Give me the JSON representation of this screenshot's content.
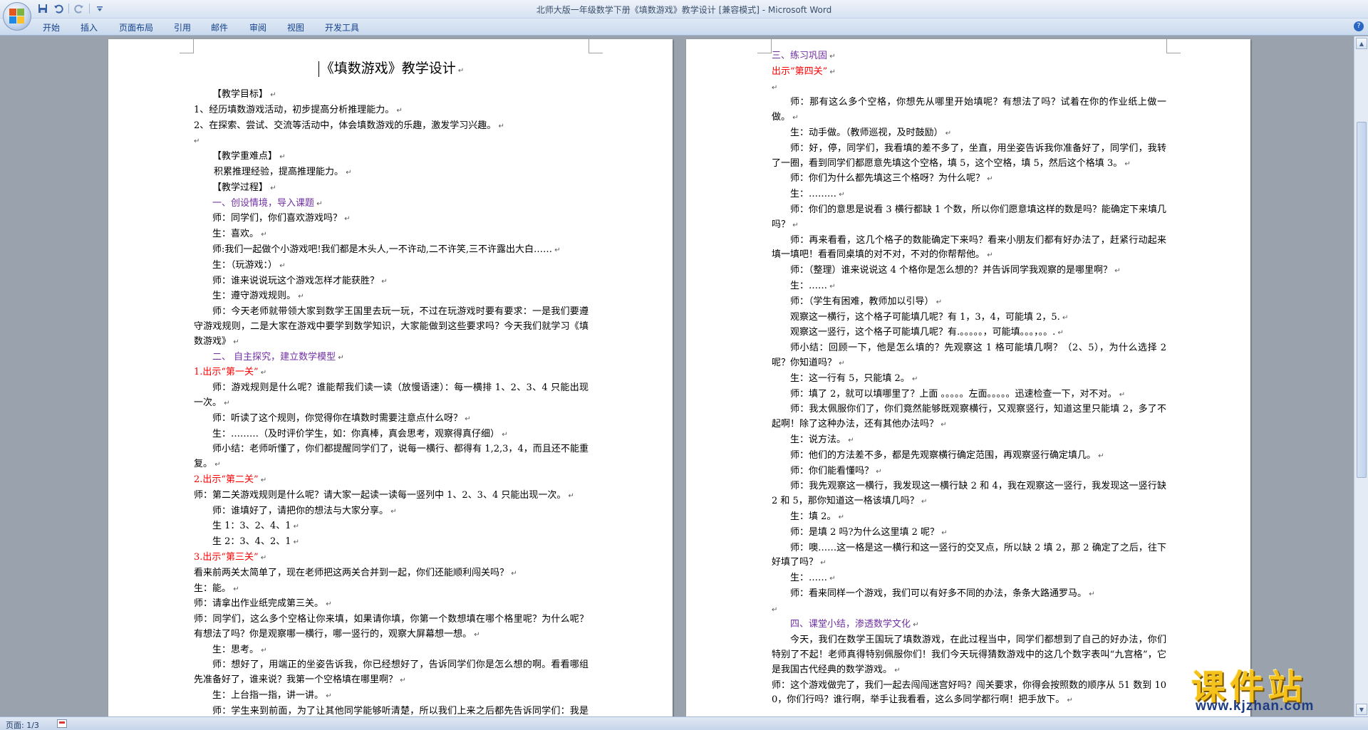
{
  "window": {
    "title": "北师大版一年级数学下册《填数游戏》教学设计 [兼容模式] - Microsoft Word"
  },
  "quick_access": {
    "icons": [
      "save-icon",
      "undo-icon",
      "redo-icon",
      "customize-icon"
    ]
  },
  "ribbon": {
    "tabs": [
      "开始",
      "插入",
      "页面布局",
      "引用",
      "邮件",
      "审阅",
      "视图",
      "开发工具"
    ],
    "help_label": "?"
  },
  "page_left": {
    "title": "《填数游戏》教学设计",
    "paragraphs": [
      {
        "text": "【教学目标】",
        "style": "ind"
      },
      {
        "text": "1、经历填数游戏活动，初步提高分析推理能力。",
        "style": ""
      },
      {
        "text": "2、在探索、尝试、交流等活动中，体会填数游戏的乐趣，激发学习兴趣。",
        "style": ""
      },
      {
        "text": "",
        "style": ""
      },
      {
        "text": "【教学重难点】",
        "style": "ind"
      },
      {
        "text": "积累推理经验，提高推理能力。",
        "style": "ind1"
      },
      {
        "text": "【教学过程】",
        "style": "ind"
      },
      {
        "text": "一、创设情境，导入课题",
        "style": "ind purple"
      },
      {
        "text": "师：同学们，你们喜欢游戏吗？",
        "style": "ind"
      },
      {
        "text": "生：喜欢。",
        "style": "ind"
      },
      {
        "text": "师:我们一起做个小游戏吧!我们都是木头人,一不许动,二不许笑,三不许露出大白……",
        "style": "ind"
      },
      {
        "text": "生：（玩游戏：）",
        "style": "ind"
      },
      {
        "text": "师：谁来说说玩这个游戏怎样才能获胜？",
        "style": "ind"
      },
      {
        "text": "生：遵守游戏规则。",
        "style": "ind"
      },
      {
        "text": "师：今天老师就带领大家到数学王国里去玩一玩，不过在玩游戏时要有要求：一是我们要遵守游戏规则，二是大家在游戏中要学到数学知识，大家能做到这些要求吗？今天我们就学习《填数游戏》",
        "style": "ind"
      },
      {
        "text": "二、 自主探究，建立数学模型",
        "style": "ind purple"
      },
      {
        "text": "1.出示“第一关”",
        "style": "red"
      },
      {
        "text": "师：游戏规则是什么呢？谁能帮我们读一读（放慢语速）：每一横排 1、2、3、4 只能出现一次。",
        "style": "ind"
      },
      {
        "text": "师：听读了这个规则，你觉得你在填数时需要注意点什么呀？",
        "style": "ind"
      },
      {
        "text": "生：………（及时评价学生，如：你真棒，真会思考，观察得真仔细）",
        "style": "ind"
      },
      {
        "text": "师小结：老师听懂了，你们都提醒同学们了，说每一横行、都得有 1,2,3，4，而且还不能重复。",
        "style": "ind"
      },
      {
        "text": "2.出示“第二关”",
        "style": "red"
      },
      {
        "text": "师：第二关游戏规则是什么呢？请大家一起读一读每一竖列中 1、2、3、4 只能出现一次。",
        "style": ""
      },
      {
        "text": "师：谁填好了，请把你的想法与大家分享。",
        "style": "ind"
      },
      {
        "text": "生 1：3、2、4、1",
        "style": "ind"
      },
      {
        "text": "生 2：3、4、2、1",
        "style": "ind"
      },
      {
        "text": "3.出示“第三关”",
        "style": "red"
      },
      {
        "text": "看来前两关太简单了，现在老师把这两关合并到一起，你们还能顺利闯关吗？",
        "style": ""
      },
      {
        "text": "生：能。",
        "style": ""
      },
      {
        "text": "师：请拿出作业纸完成第三关。",
        "style": ""
      },
      {
        "text": "师：同学们，这么多个空格让你来填，如果请你填，你第一个数想填在哪个格里呢？为什么呢？有想法了吗？你是观察哪一横行，哪一竖行的，观察大屏幕想一想。",
        "style": ""
      },
      {
        "text": "生：思考。",
        "style": "ind"
      },
      {
        "text": "师：想好了，用端正的坐姿告诉我，你已经想好了，告诉同学们你是怎么想的啊。看看哪组先准备好了，谁来说？我第一个空格填在哪里啊？",
        "style": "ind"
      },
      {
        "text": "生：上台指一指，讲一讲。",
        "style": "ind"
      },
      {
        "text": "师：学生来到前面，为了让其他同学能够听清楚，所以我们上来之后都先告诉同学们：我是观察的这一横行，还是观察这一竖行，行吗？",
        "style": "ind"
      }
    ]
  },
  "page_right": {
    "paragraphs": [
      {
        "text": "三、练习巩固",
        "style": "purple"
      },
      {
        "text": "出示“第四关”",
        "style": "red"
      },
      {
        "text": "",
        "style": ""
      },
      {
        "text": "师：那有这么多个空格，你想先从哪里开始填呢？有想法了吗？试着在你的作业纸上做一做。",
        "style": "ind"
      },
      {
        "text": "生：动手做。（教师巡视，及时鼓励）",
        "style": "ind"
      },
      {
        "text": "师：好，停，同学们，我看填的差不多了，坐直，用坐姿告诉我你准备好了，同学们，我转了一圈，看到同学们都愿意先填这个空格，填 5，这个空格，填 5，然后这个格填 3。",
        "style": "ind"
      },
      {
        "text": "师：你们为什么都先填这三个格呀？为什么呢？",
        "style": "ind"
      },
      {
        "text": "生：………",
        "style": "ind"
      },
      {
        "text": "师：你们的意思是说看 3 横行都缺 1 个数，所以你们愿意填这样的数是吗？能确定下来填几吗？",
        "style": "ind"
      },
      {
        "text": "师：再来看看，这几个格子的数能确定下来吗？看来小朋友们都有好办法了，赶紧行动起来填一填吧！看看同桌填的对不对，不对的你帮帮他。",
        "style": "ind"
      },
      {
        "text": "师：（整理）谁来说说这 4 个格你是怎么想的？并告诉同学我观察的是哪里啊？",
        "style": "ind"
      },
      {
        "text": "生：……",
        "style": "ind"
      },
      {
        "text": "师：（学生有困难，教师加以引导）",
        "style": "ind"
      },
      {
        "text": "观察这一横行，这个格子可能填几呢？有 1，3，4，可能填 2，5.",
        "style": "ind"
      },
      {
        "text": "观察这一竖行，这个格子可能填几呢？有.。。。。。，可能填。。。，。。.",
        "style": "ind"
      },
      {
        "text": "师小结：回顾一下，他是怎么填的？先观察这 1 格可能填几啊？（2、5），为什么选择 2 呢？你知道吗？",
        "style": "ind"
      },
      {
        "text": "生：这一行有 5，只能填 2。",
        "style": "ind"
      },
      {
        "text": "师：填了 2，就可以填哪里了？上面 。。。。。左面。。。。。迅速检查一下，对不对。",
        "style": "ind"
      },
      {
        "text": "师：我太佩服你们了，你们竟然能够既观察横行，又观察竖行，知道这里只能填 2，多了不起啊！除了这种办法，还有其他办法吗？",
        "style": "ind"
      },
      {
        "text": "生：说方法。",
        "style": "ind"
      },
      {
        "text": "师：他们的方法差不多，都是先观察横行确定范围，再观察竖行确定填几。",
        "style": "ind"
      },
      {
        "text": "师：你们能看懂吗？",
        "style": "ind"
      },
      {
        "text": "师：我先观察这一横行，我发现这一横行缺 2 和 4，我在观察这一竖行，我发现这一竖行缺 2 和 5，那你知道这一格该填几吗？",
        "style": "ind"
      },
      {
        "text": "生：填 2。",
        "style": "ind"
      },
      {
        "text": "师：是填 2 吗?为什么这里填 2 呢？",
        "style": "ind"
      },
      {
        "text": "师：噢……这一格是这一横行和这一竖行的交叉点，所以缺 2 填 2，那 2 确定了之后，往下好填了吗？",
        "style": "ind"
      },
      {
        "text": "生：……",
        "style": "ind"
      },
      {
        "text": "师：看来同样一个游戏，我们可以有好多不同的办法，条条大路通罗马。",
        "style": "ind"
      },
      {
        "text": "",
        "style": ""
      },
      {
        "text": "四、课堂小结，渗透数学文化",
        "style": "ind purple"
      },
      {
        "text": "今天，我们在数学王国玩了填数游戏，在此过程当中，同学们都想到了自己的好办法，你们特别了不起！老师真得特别佩服你们！我们今天玩得猜数游戏中的这几个数字表叫“九宫格”，它是我国古代经典的数学游戏。",
        "style": "ind"
      },
      {
        "text": "师：这个游戏做完了，我们一起去闯闯迷宫好吗？闯关要求，你得会按照数的顺序从 51 数到 100，你们行吗？谁行啊，举手让我看看，这么多同学都行啊！把手放下。",
        "style": ""
      }
    ]
  },
  "status": {
    "page_info": "页面: 1/3"
  },
  "watermark": {
    "main": "课件站",
    "url": "www.kjzhan.com"
  },
  "colors": {
    "purple": "#7030a0",
    "red": "#ff0000",
    "background": "#9aa3ad"
  }
}
